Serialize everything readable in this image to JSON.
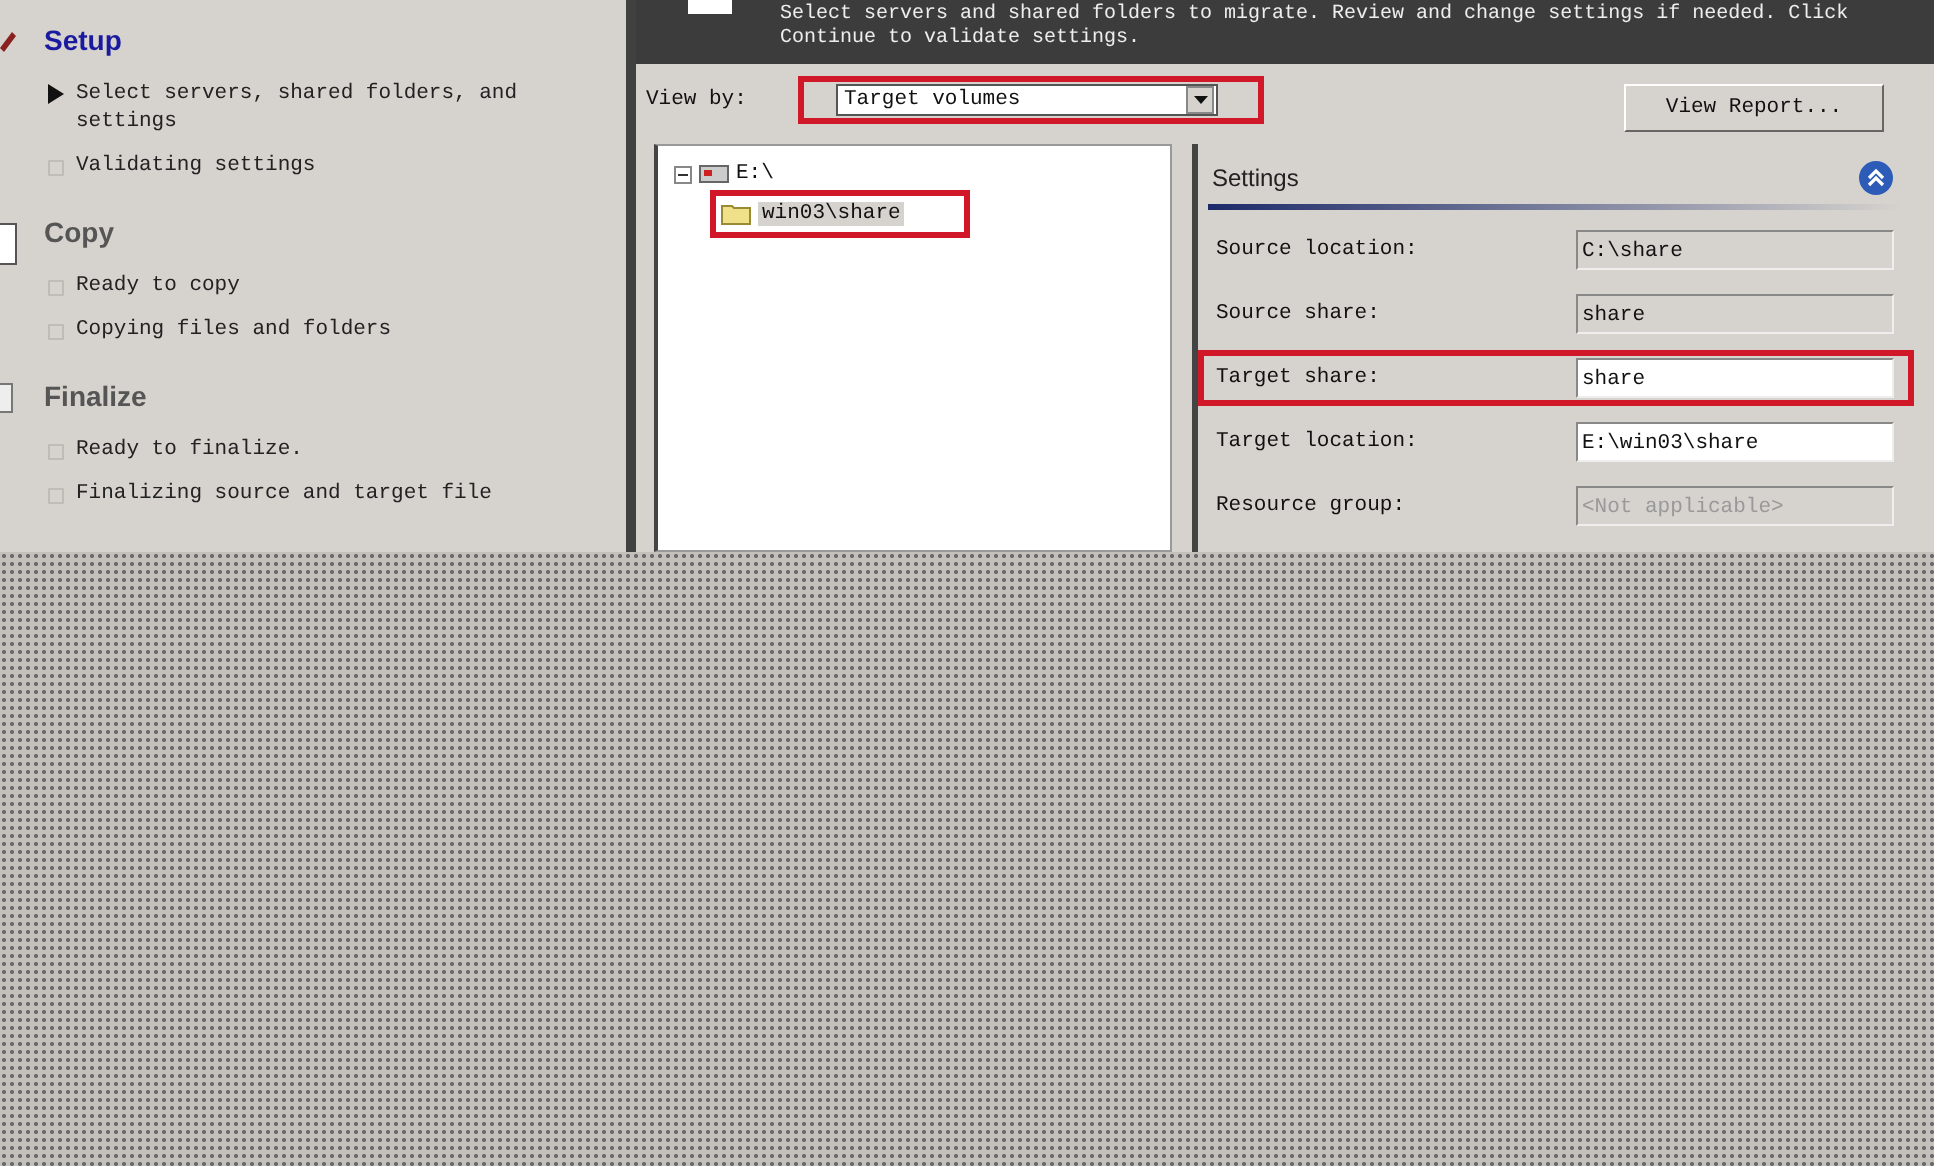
{
  "sidebar": {
    "groups": [
      {
        "title": "Setup",
        "active": true,
        "items": [
          {
            "label": "Select servers, shared folders, and settings",
            "current": true
          },
          {
            "label": "Validating settings",
            "current": false
          }
        ]
      },
      {
        "title": "Copy",
        "active": false,
        "items": [
          {
            "label": "Ready to copy",
            "current": false
          },
          {
            "label": "Copying files and folders",
            "current": false
          }
        ]
      },
      {
        "title": "Finalize",
        "active": false,
        "items": [
          {
            "label": "Ready to finalize.",
            "current": false
          },
          {
            "label": "Finalizing source and target file",
            "current": false
          }
        ]
      }
    ]
  },
  "header": {
    "instructions": [
      "Select servers and shared folders to migrate. Review and change settings if needed. Click",
      "Continue to validate settings."
    ]
  },
  "view_by": {
    "label": "View by:",
    "value": "Target volumes",
    "highlighted": true
  },
  "view_report_button": "View Report...",
  "tree": {
    "items": [
      {
        "label": "E:\\",
        "expanded": true,
        "selected": false,
        "children": [
          {
            "label": "win03\\share",
            "selected": true,
            "highlighted": true
          }
        ]
      }
    ]
  },
  "settings": {
    "title": "Settings",
    "fields": [
      {
        "label": "Source location:",
        "value": "C:\\share",
        "readonly": true,
        "disabled": false,
        "highlighted": false
      },
      {
        "label": "Source share:",
        "value": "share",
        "readonly": true,
        "disabled": false,
        "highlighted": false
      },
      {
        "label": "Target share:",
        "value": "share",
        "readonly": false,
        "disabled": false,
        "highlighted": true
      },
      {
        "label": "Target location:",
        "value": "E:\\win03\\share",
        "readonly": false,
        "disabled": false,
        "highlighted": false
      },
      {
        "label": "Resource group:",
        "value": "<Not applicable>",
        "readonly": true,
        "disabled": true,
        "highlighted": false
      }
    ]
  }
}
